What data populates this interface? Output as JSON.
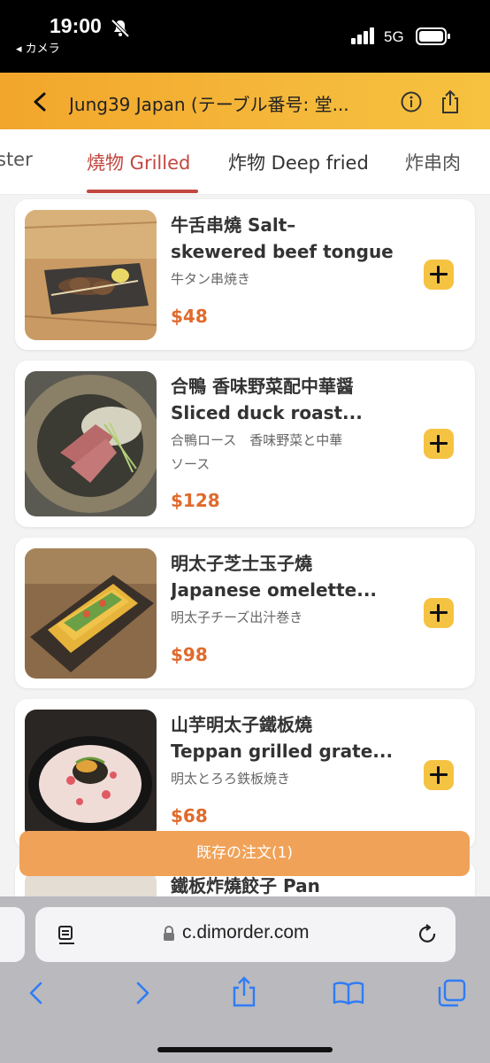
{
  "status_bar": {
    "time": "19:00",
    "back_app": "◂ カメラ",
    "network": "5G"
  },
  "header": {
    "title": "Jung39 Japan (テーブル番号: 堂..."
  },
  "tabs": [
    {
      "label": "ster"
    },
    {
      "label": "燒物 Grilled"
    },
    {
      "label": "炸物 Deep fried"
    },
    {
      "label": "炸串肉"
    }
  ],
  "items": [
    {
      "name_jp": "牛舌串燒 Salt–",
      "name_en": "skewered beef tongue",
      "subtitle": "牛タン串焼き",
      "subtitle2": "",
      "price": "$48"
    },
    {
      "name_jp": "合鴨 香味野菜配中華醤",
      "name_en": "Sliced duck roast...",
      "subtitle": "合鴨ロース　香味野菜と中華",
      "subtitle2": "ソース",
      "price": "$128"
    },
    {
      "name_jp": "明太子芝士玉子燒",
      "name_en": "Japanese omelette...",
      "subtitle": "明太子チーズ出汁巻き",
      "subtitle2": "",
      "price": "$98"
    },
    {
      "name_jp": "山芋明太子鐵板燒",
      "name_en": "Teppan grilled grate...",
      "subtitle": "明太とろろ鉄板焼き",
      "subtitle2": "",
      "price": "$68"
    },
    {
      "name_jp": "鐵板炸燒餃子 Pan",
      "name_en": "",
      "subtitle": "",
      "subtitle2": "",
      "price": ""
    }
  ],
  "saved_order": {
    "label": "既存の注文(1)"
  },
  "browser": {
    "url": "c.dimorder.com"
  },
  "colors": {
    "header_accent": "#f5b83a",
    "tab_active": "#c2473f",
    "price": "#e06a2c",
    "add_button": "#f5c342",
    "saved_order_bar": "#f0a258"
  },
  "icons": [
    "bell-slash-icon",
    "signal-icon",
    "battery-icon",
    "back-chevron-icon",
    "info-icon",
    "share-icon",
    "plus-icon",
    "reader-icon",
    "lock-icon",
    "reload-icon",
    "back-arrow-icon",
    "forward-arrow-icon",
    "bookmarks-icon",
    "tabs-icon"
  ]
}
